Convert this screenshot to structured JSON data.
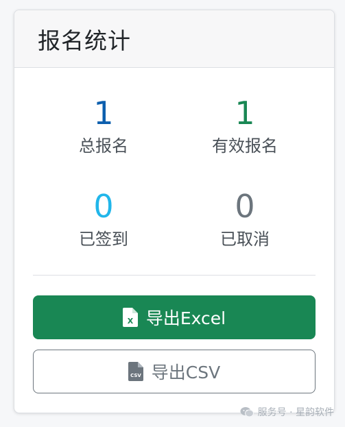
{
  "card": {
    "title": "报名统计"
  },
  "stats": [
    {
      "value": "1",
      "label": "总报名",
      "color": "#0d5fae"
    },
    {
      "value": "1",
      "label": "有效报名",
      "color": "#198754"
    },
    {
      "value": "0",
      "label": "已签到",
      "color": "#21b6ea"
    },
    {
      "value": "0",
      "label": "已取消",
      "color": "#6c757d"
    }
  ],
  "buttons": {
    "export_excel": {
      "label": "导出Excel",
      "icon": "file-excel-icon"
    },
    "export_csv": {
      "label": "导出CSV",
      "icon": "file-csv-icon"
    }
  },
  "watermark": {
    "text": "服务号 · 星韵软件",
    "icon": "wechat-icon"
  }
}
